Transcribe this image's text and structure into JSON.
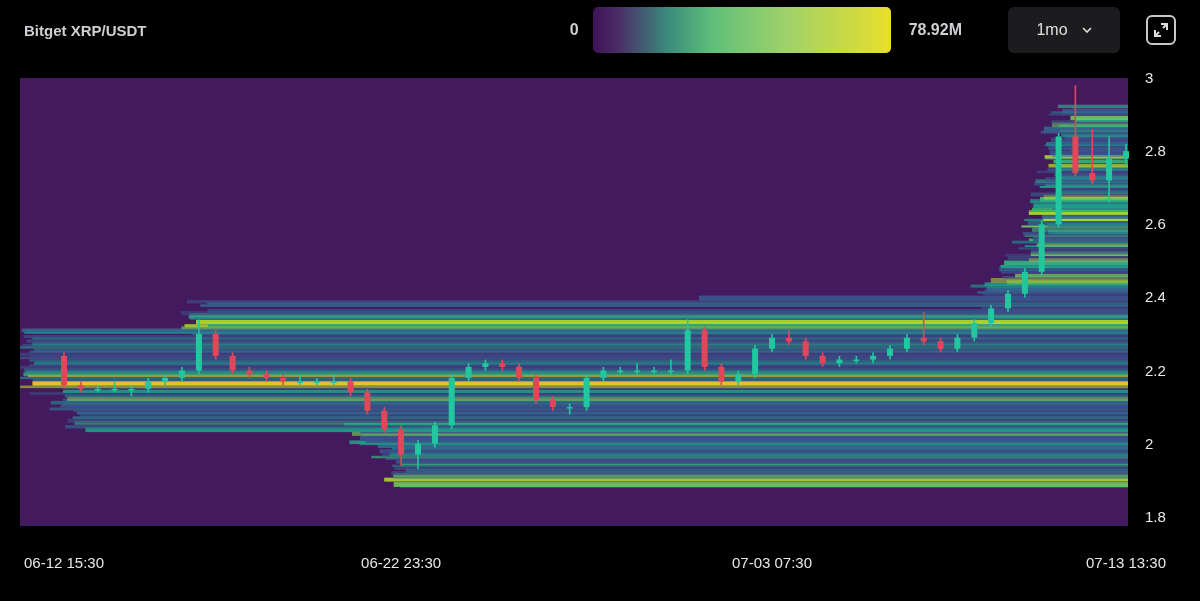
{
  "chart": {
    "title": "Bitget XRP/USDT"
  },
  "color_scale": {
    "min_label": "0",
    "max_label": "78.92M"
  },
  "timeframe": {
    "value": "1mo"
  },
  "chart_data": {
    "type": "candlestick",
    "ylim": [
      1.775,
      3
    ],
    "yticks": [
      3,
      2.8,
      2.6,
      2.4,
      2.2,
      2,
      1.8
    ],
    "categories": [
      "06-12 15:30",
      null,
      null,
      null,
      null,
      null,
      null,
      null,
      null,
      null,
      null,
      null,
      null,
      null,
      null,
      null,
      null,
      null,
      null,
      null,
      "06-22 23:30",
      null,
      null,
      null,
      null,
      null,
      null,
      null,
      null,
      null,
      null,
      null,
      null,
      null,
      null,
      null,
      null,
      null,
      null,
      null,
      null,
      null,
      "07-03 07:30",
      null,
      null,
      null,
      null,
      null,
      null,
      null,
      null,
      null,
      null,
      null,
      null,
      null,
      null,
      null,
      null,
      null,
      null,
      null,
      null,
      "07-13 13:30"
    ],
    "ohlc": [
      [
        2.24,
        2.25,
        2.15,
        2.16
      ],
      [
        2.16,
        2.17,
        2.14,
        2.15
      ],
      [
        2.15,
        2.16,
        2.14,
        2.15
      ],
      [
        2.15,
        2.17,
        2.14,
        2.15
      ],
      [
        2.15,
        2.16,
        2.13,
        2.15
      ],
      [
        2.15,
        2.18,
        2.14,
        2.17
      ],
      [
        2.17,
        2.19,
        2.16,
        2.18
      ],
      [
        2.18,
        2.21,
        2.17,
        2.2
      ],
      [
        2.2,
        2.34,
        2.19,
        2.3
      ],
      [
        2.3,
        2.31,
        2.23,
        2.24
      ],
      [
        2.24,
        2.25,
        2.19,
        2.2
      ],
      [
        2.2,
        2.21,
        2.18,
        2.19
      ],
      [
        2.19,
        2.2,
        2.17,
        2.18
      ],
      [
        2.18,
        2.19,
        2.16,
        2.17
      ],
      [
        2.17,
        2.19,
        2.16,
        2.17
      ],
      [
        2.17,
        2.18,
        2.16,
        2.17
      ],
      [
        2.17,
        2.19,
        2.16,
        2.17
      ],
      [
        2.17,
        2.18,
        2.13,
        2.14
      ],
      [
        2.14,
        2.15,
        2.08,
        2.09
      ],
      [
        2.09,
        2.1,
        2.03,
        2.04
      ],
      [
        2.04,
        2.05,
        1.94,
        1.97
      ],
      [
        1.97,
        2.01,
        1.93,
        2
      ],
      [
        2,
        2.06,
        1.99,
        2.05
      ],
      [
        2.05,
        2.19,
        2.04,
        2.18
      ],
      [
        2.18,
        2.22,
        2.17,
        2.21
      ],
      [
        2.21,
        2.23,
        2.2,
        2.22
      ],
      [
        2.22,
        2.23,
        2.2,
        2.21
      ],
      [
        2.21,
        2.22,
        2.17,
        2.18
      ],
      [
        2.18,
        2.19,
        2.11,
        2.12
      ],
      [
        2.12,
        2.13,
        2.09,
        2.1
      ],
      [
        2.1,
        2.11,
        2.08,
        2.1
      ],
      [
        2.1,
        2.19,
        2.09,
        2.18
      ],
      [
        2.18,
        2.21,
        2.17,
        2.2
      ],
      [
        2.2,
        2.21,
        2.19,
        2.2
      ],
      [
        2.2,
        2.22,
        2.19,
        2.2
      ],
      [
        2.2,
        2.21,
        2.19,
        2.2
      ],
      [
        2.2,
        2.23,
        2.19,
        2.2
      ],
      [
        2.2,
        2.34,
        2.19,
        2.31
      ],
      [
        2.31,
        2.32,
        2.2,
        2.21
      ],
      [
        2.21,
        2.22,
        2.16,
        2.17
      ],
      [
        2.17,
        2.2,
        2.16,
        2.19
      ],
      [
        2.19,
        2.27,
        2.18,
        2.26
      ],
      [
        2.26,
        2.3,
        2.25,
        2.29
      ],
      [
        2.29,
        2.31,
        2.27,
        2.28
      ],
      [
        2.28,
        2.29,
        2.23,
        2.24
      ],
      [
        2.24,
        2.25,
        2.21,
        2.22
      ],
      [
        2.22,
        2.24,
        2.21,
        2.23
      ],
      [
        2.23,
        2.24,
        2.22,
        2.23
      ],
      [
        2.23,
        2.25,
        2.22,
        2.24
      ],
      [
        2.24,
        2.27,
        2.23,
        2.26
      ],
      [
        2.26,
        2.3,
        2.25,
        2.29
      ],
      [
        2.29,
        2.36,
        2.27,
        2.28
      ],
      [
        2.28,
        2.29,
        2.25,
        2.26
      ],
      [
        2.26,
        2.3,
        2.25,
        2.29
      ],
      [
        2.29,
        2.34,
        2.28,
        2.33
      ],
      [
        2.33,
        2.38,
        2.32,
        2.37
      ],
      [
        2.37,
        2.42,
        2.36,
        2.41
      ],
      [
        2.41,
        2.48,
        2.4,
        2.47
      ],
      [
        2.47,
        2.61,
        2.46,
        2.6
      ],
      [
        2.6,
        2.85,
        2.59,
        2.84
      ],
      [
        2.84,
        2.98,
        2.73,
        2.74
      ],
      [
        2.74,
        2.86,
        2.71,
        2.72
      ],
      [
        2.72,
        2.84,
        2.66,
        2.78
      ],
      [
        2.78,
        2.82,
        2.76,
        2.8
      ]
    ]
  }
}
